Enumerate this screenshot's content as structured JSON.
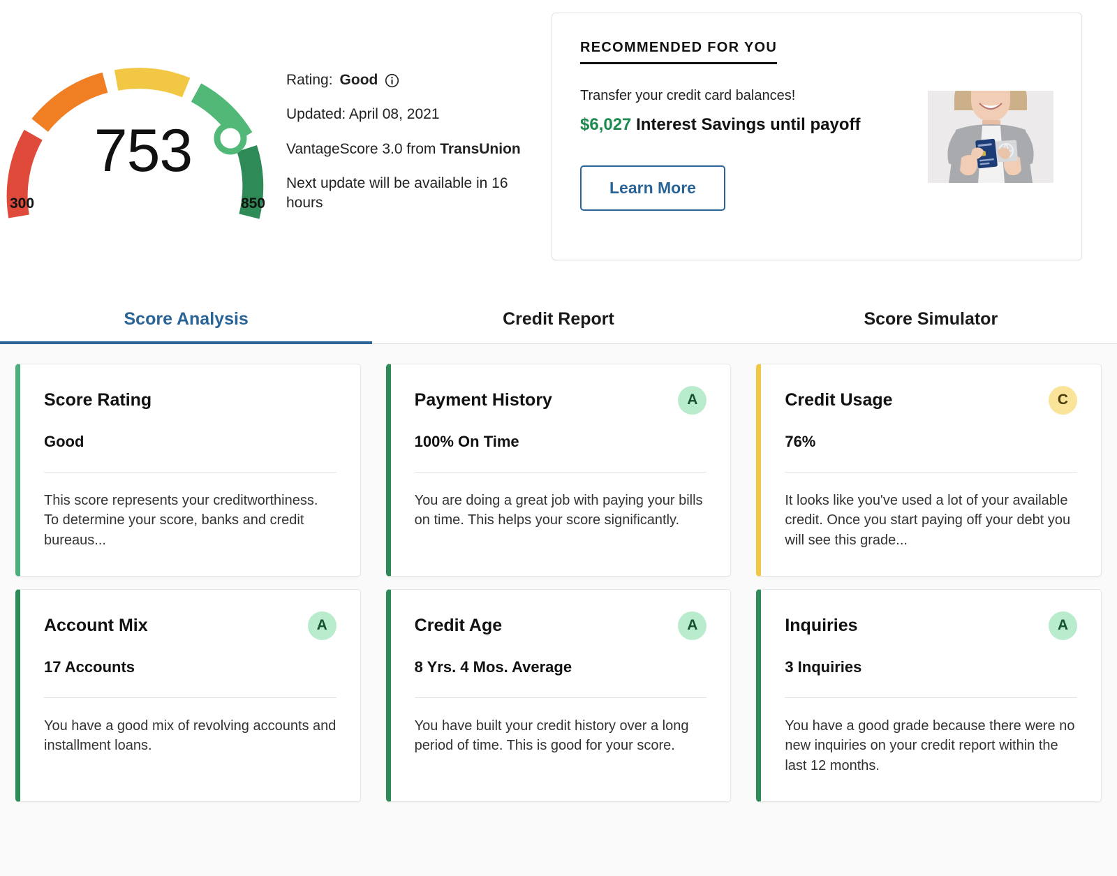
{
  "score_gauge": {
    "score": "753",
    "min_label": "300",
    "max_label": "850",
    "segment_colors": [
      "#e04a3b",
      "#f07e22",
      "#f2c744",
      "#52b877",
      "#2e8b57"
    ],
    "marker_color": "#52b877"
  },
  "score_meta": {
    "rating_label": "Rating:",
    "rating_value": "Good",
    "info_icon": "info-icon",
    "updated": "Updated: April 08, 2021",
    "model_prefix": "VantageScore 3.0 from ",
    "model_bureau": "TransUnion",
    "next_update": "Next update will be available in 16 hours"
  },
  "recommended": {
    "heading": "RECOMMENDED FOR YOU",
    "tagline": "Transfer your credit card balances!",
    "amount": "$6,027",
    "amount_color": "#1d8a4e",
    "offer_text": " Interest Savings until payoff",
    "button_label": "Learn More",
    "button_color": "#2a6496",
    "image_alt": "woman-holding-credit-cards-photo"
  },
  "tabs": {
    "active_color": "#2a6496",
    "items": [
      {
        "label": "Score Analysis",
        "active": true
      },
      {
        "label": "Credit Report",
        "active": false
      },
      {
        "label": "Score Simulator",
        "active": false
      }
    ]
  },
  "factors": [
    {
      "title": "Score Rating",
      "value": "Good",
      "grade": "",
      "accent": "#4caf7d",
      "badge_bg": "",
      "badge_fg": "",
      "description": "This score represents your creditworthiness. To determine your score, banks and credit bureaus..."
    },
    {
      "title": "Payment History",
      "value": "100% On Time",
      "grade": "A",
      "accent": "#2e8b57",
      "badge_bg": "#b8eccd",
      "badge_fg": "#14532d",
      "description": "You are doing a great job with paying your bills on time. This helps your score significantly."
    },
    {
      "title": "Credit Usage",
      "value": "76%",
      "grade": "C",
      "accent": "#f2c744",
      "badge_bg": "#fae49a",
      "badge_fg": "#4a3b0a",
      "description": "It looks like you've used a lot of your available credit. Once you start paying off your debt you will see this grade..."
    },
    {
      "title": "Account Mix",
      "value": "17 Accounts",
      "grade": "A",
      "accent": "#2e8b57",
      "badge_bg": "#b8eccd",
      "badge_fg": "#14532d",
      "description": "You have a good mix of revolving accounts and installment loans."
    },
    {
      "title": "Credit Age",
      "value": "8 Yrs. 4 Mos. Average",
      "grade": "A",
      "accent": "#2e8b57",
      "badge_bg": "#b8eccd",
      "badge_fg": "#14532d",
      "description": "You have built your credit history over a long period of time. This is good for your score."
    },
    {
      "title": "Inquiries",
      "value": "3 Inquiries",
      "grade": "A",
      "accent": "#2e8b57",
      "badge_bg": "#b8eccd",
      "badge_fg": "#14532d",
      "description": "You have a good grade because there were no new inquiries on your credit report within the last 12 months."
    }
  ]
}
